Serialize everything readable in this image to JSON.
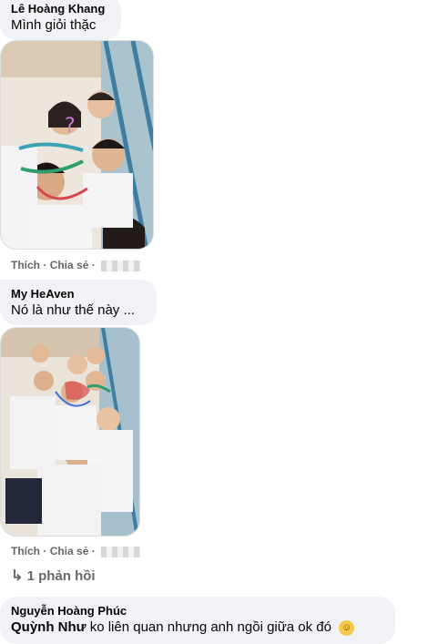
{
  "comments": [
    {
      "author": "Lê Hoàng Khang",
      "text": "Mình giỏi thặc",
      "actions": {
        "like": "Thích",
        "reply": "Chia sẻ"
      }
    },
    {
      "author": "My HeAven",
      "text": "Nó là như thế này ...",
      "actions": {
        "like": "Thích",
        "reply": "Chia sẻ"
      },
      "replies_label": "1 phản hồi"
    },
    {
      "author": "Nguyễn Hoàng Phúc",
      "mention": "Quỳnh Như",
      "text": "ko liên quan nhưng anh ngồi giữa ok đó",
      "emoji": "smiling-face-icon"
    }
  ],
  "separator": "·",
  "colors": {
    "bubble": "#f0f2f5",
    "meta": "#65676b",
    "text": "#050505"
  }
}
